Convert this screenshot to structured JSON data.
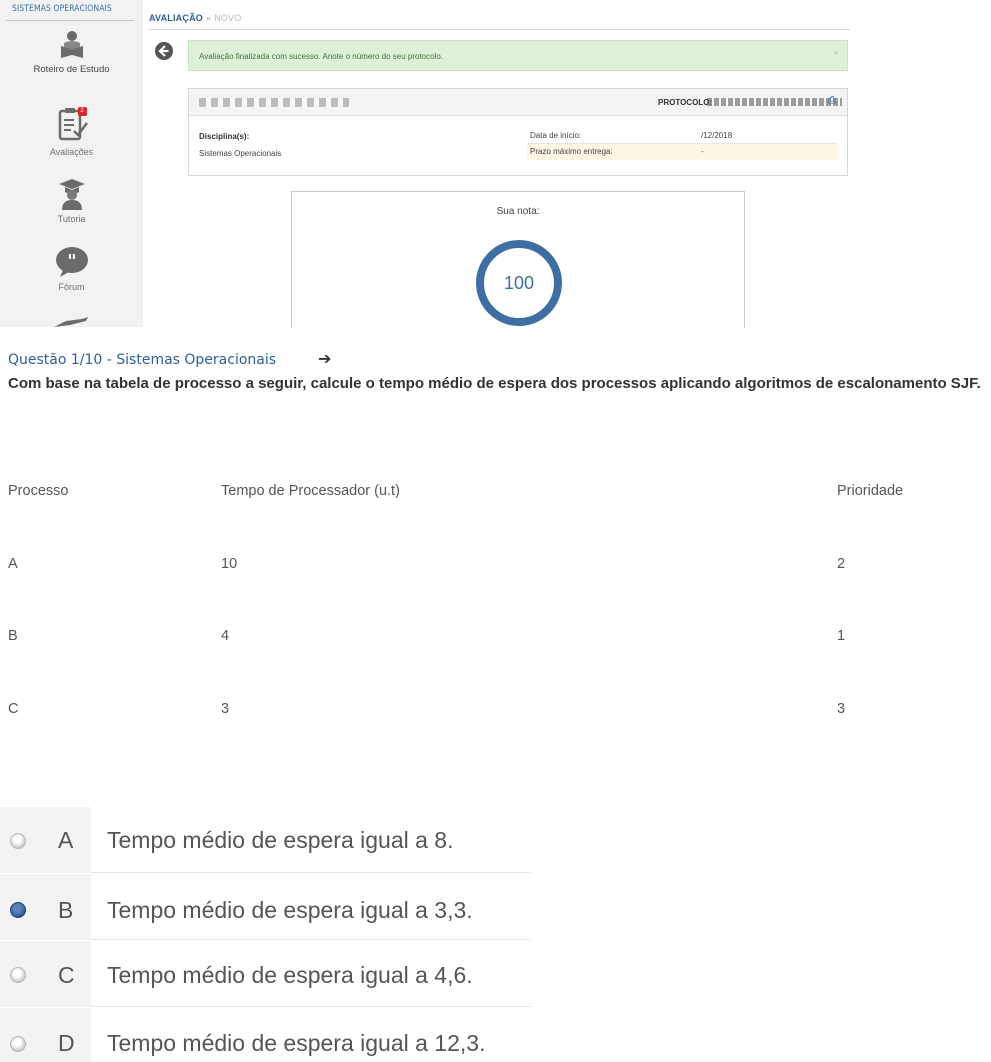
{
  "sidebar": {
    "section_title": "SISTEMAS OPERACIONAIS",
    "items": [
      {
        "label": "Roteiro de Estudo",
        "icon": "reader-icon"
      },
      {
        "label": "Avaliações",
        "icon": "checklist-icon",
        "badge": "2"
      },
      {
        "label": "Tutoria",
        "icon": "graduate-icon"
      },
      {
        "label": "Fórum",
        "icon": "speech-bubble-icon"
      }
    ]
  },
  "breadcrumb": {
    "section": "AVALIAÇÃO",
    "separator": "»",
    "current": "NOVO"
  },
  "alert": {
    "message": "Avaliação finalizada com sucesso. Anote o número do seu protocolo.",
    "close": "×"
  },
  "card": {
    "protocol_label": "PROTOCOLO:",
    "discipline_label": "Disciplina(s):",
    "discipline_value": "Sistemas Operacionais",
    "start_label": "Data de início:",
    "start_value": "/12/2018",
    "deadline_label": "Prazo máximo entrega:",
    "deadline_value": "-"
  },
  "grade": {
    "title": "Sua nota:",
    "value": "100"
  },
  "question": {
    "title": "Questão 1/10 - Sistemas Operacionais",
    "text": "Com base na tabela de processo a seguir, calcule o tempo médio de espera dos processos aplicando algoritmos de escalonamento SJF."
  },
  "table": {
    "headers": [
      "Processo",
      "Tempo de Processador (u.t)",
      "Prioridade"
    ],
    "rows": [
      [
        "A",
        "10",
        "2"
      ],
      [
        "B",
        "4",
        "1"
      ],
      [
        "C",
        "3",
        "3"
      ]
    ]
  },
  "options": [
    {
      "letter": "A",
      "text": "Tempo médio de espera igual a 8.",
      "selected": false
    },
    {
      "letter": "B",
      "text": "Tempo médio de espera igual a 3,3.",
      "selected": true
    },
    {
      "letter": "C",
      "text": "Tempo médio de espera igual a 4,6.",
      "selected": false
    },
    {
      "letter": "D",
      "text": "Tempo médio de espera igual a 12,3.",
      "selected": false
    }
  ],
  "colors": {
    "accent": "#2d5c94",
    "success_bg": "#dff0d8",
    "ring": "#3f6ea4"
  }
}
